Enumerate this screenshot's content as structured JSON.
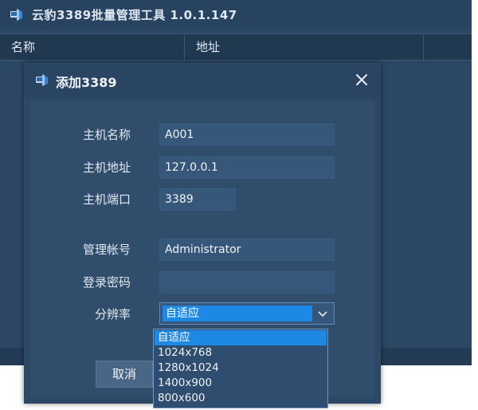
{
  "app": {
    "title": "云豹3389批量管理工具 1.0.1.147"
  },
  "list": {
    "columns": [
      "名称",
      "地址",
      ""
    ]
  },
  "dialog": {
    "title": "添加3389",
    "fields": {
      "host_name": {
        "label": "主机名称",
        "value": "A001"
      },
      "host_address": {
        "label": "主机地址",
        "value": "127.0.0.1"
      },
      "host_port": {
        "label": "主机端口",
        "value": "3389"
      },
      "admin_account": {
        "label": "管理帐号",
        "value": "Administrator"
      },
      "login_password": {
        "label": "登录密码",
        "value": ""
      },
      "resolution": {
        "label": "分辨率",
        "selected": "自适应",
        "options": [
          "自适应",
          "1024x768",
          "1280x1024",
          "1400x900",
          "800x600"
        ]
      }
    },
    "cancel_label": "取消"
  },
  "colors": {
    "window_bg": "#2c4763",
    "accent": "#1e88e5",
    "field_bg": "#37577a"
  },
  "icons": {
    "app": "app-logo-icon",
    "close": "close-icon",
    "dropdown": "chevron-down-icon"
  }
}
